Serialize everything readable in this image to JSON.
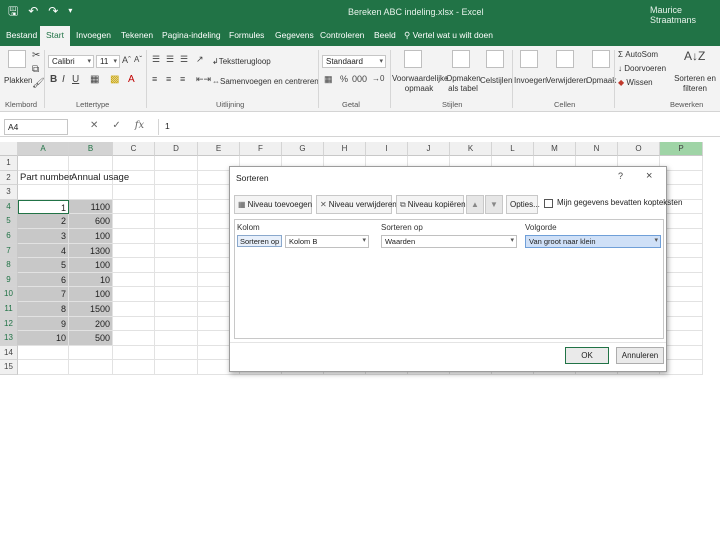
{
  "titlebar": {
    "title": "Bereken ABC indeling.xlsx - Excel",
    "user": "Maurice Straatmans"
  },
  "tabs": [
    "Bestand",
    "Start",
    "Invoegen",
    "Tekenen",
    "Pagina-indeling",
    "Formules",
    "Gegevens",
    "Controleren",
    "Beeld"
  ],
  "active_tab": "Start",
  "tell_me": "Vertel wat u wilt doen",
  "ribbon": {
    "plakken": "Plakken",
    "font_name": "Calibri",
    "font_size": "11",
    "wrap_text": "Tekstterugloop",
    "merge_center": "Samenvoegen en centreren",
    "number_format": "Standaard",
    "cond_format": "Voorwaardelijke opmaak",
    "format_table": "Opmaken als tabel",
    "cell_styles": "Celstijlen",
    "insert": "Invoegen",
    "delete": "Verwijderen",
    "format": "Opmaak",
    "autosum": "AutoSom",
    "fill": "Doorvoeren",
    "clear": "Wissen",
    "sort_filter": "Sorteren en filteren",
    "groups": {
      "klembord": "Klembord",
      "lettertype": "Lettertype",
      "uitlijning": "Uitlijning",
      "getal": "Getal",
      "stijlen": "Stijlen",
      "cellen": "Cellen",
      "bewerken": "Bewerken"
    }
  },
  "formula_bar": {
    "name_box": "A4",
    "formula": "1"
  },
  "columns": [
    "A",
    "B",
    "C",
    "D",
    "E",
    "F",
    "G",
    "H",
    "I",
    "J",
    "K",
    "L",
    "M",
    "N",
    "O",
    "P"
  ],
  "rows": [
    "1",
    "2",
    "3",
    "4",
    "5",
    "6",
    "7",
    "8",
    "9",
    "10",
    "11",
    "12",
    "13",
    "14",
    "15"
  ],
  "sheet": {
    "header_a": "Part number",
    "header_b": "Annual usage",
    "data": [
      {
        "part": "1",
        "usage": "1100"
      },
      {
        "part": "2",
        "usage": "600"
      },
      {
        "part": "3",
        "usage": "100"
      },
      {
        "part": "4",
        "usage": "1300"
      },
      {
        "part": "5",
        "usage": "100"
      },
      {
        "part": "6",
        "usage": "10"
      },
      {
        "part": "7",
        "usage": "100"
      },
      {
        "part": "8",
        "usage": "1500"
      },
      {
        "part": "9",
        "usage": "200"
      },
      {
        "part": "10",
        "usage": "500"
      }
    ]
  },
  "dialog": {
    "title": "Sorteren",
    "help": "?",
    "close": "×",
    "add_level": "Niveau toevoegen",
    "delete_level": "Niveau verwijderen",
    "copy_level": "Niveau kopiëren",
    "options": "Opties...",
    "has_headers": "Mijn gegevens bevatten kopteksten",
    "col_header": "Kolom",
    "sort_on_header": "Sorteren op",
    "order_header": "Volgorde",
    "row_label": "Sorteren op",
    "column_value": "Kolom B",
    "sort_on_value": "Waarden",
    "order_value": "Van groot naar klein",
    "ok": "OK",
    "cancel": "Annuleren"
  },
  "colors": {
    "excel_green": "#217346",
    "ribbon_bg": "#f3f3f3",
    "selection_gray": "#c8c8c8",
    "highlight_blue": "#cfe0f7"
  }
}
